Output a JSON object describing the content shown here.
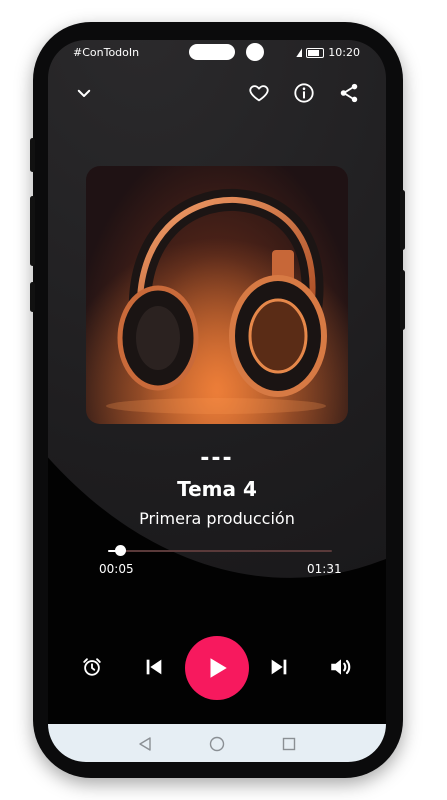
{
  "status_bar": {
    "carrier": "#ConTodoIn",
    "time": "10:20"
  },
  "toolbar": {
    "collapse_icon": "chevron-down-icon",
    "favorite_icon": "heart-icon",
    "info_icon": "info-icon",
    "share_icon": "share-icon"
  },
  "track": {
    "album": "---",
    "title": "Tema 4",
    "artist": "Primera producción",
    "cover_art": "headphones-image"
  },
  "playback": {
    "elapsed": "00:05",
    "duration": "01:31",
    "progress_fraction": 0.055
  },
  "controls": {
    "timer_icon": "alarm-clock-icon",
    "previous_icon": "skip-previous-icon",
    "play_icon": "play-icon",
    "next_icon": "skip-next-icon",
    "volume_icon": "volume-icon"
  },
  "colors": {
    "accent": "#f7195e",
    "background": "#0b0b0c",
    "nav_bar": "#e6eef4"
  },
  "android_nav": {
    "back_icon": "back-triangle-icon",
    "home_icon": "home-circle-icon",
    "recents_icon": "recents-square-icon"
  }
}
